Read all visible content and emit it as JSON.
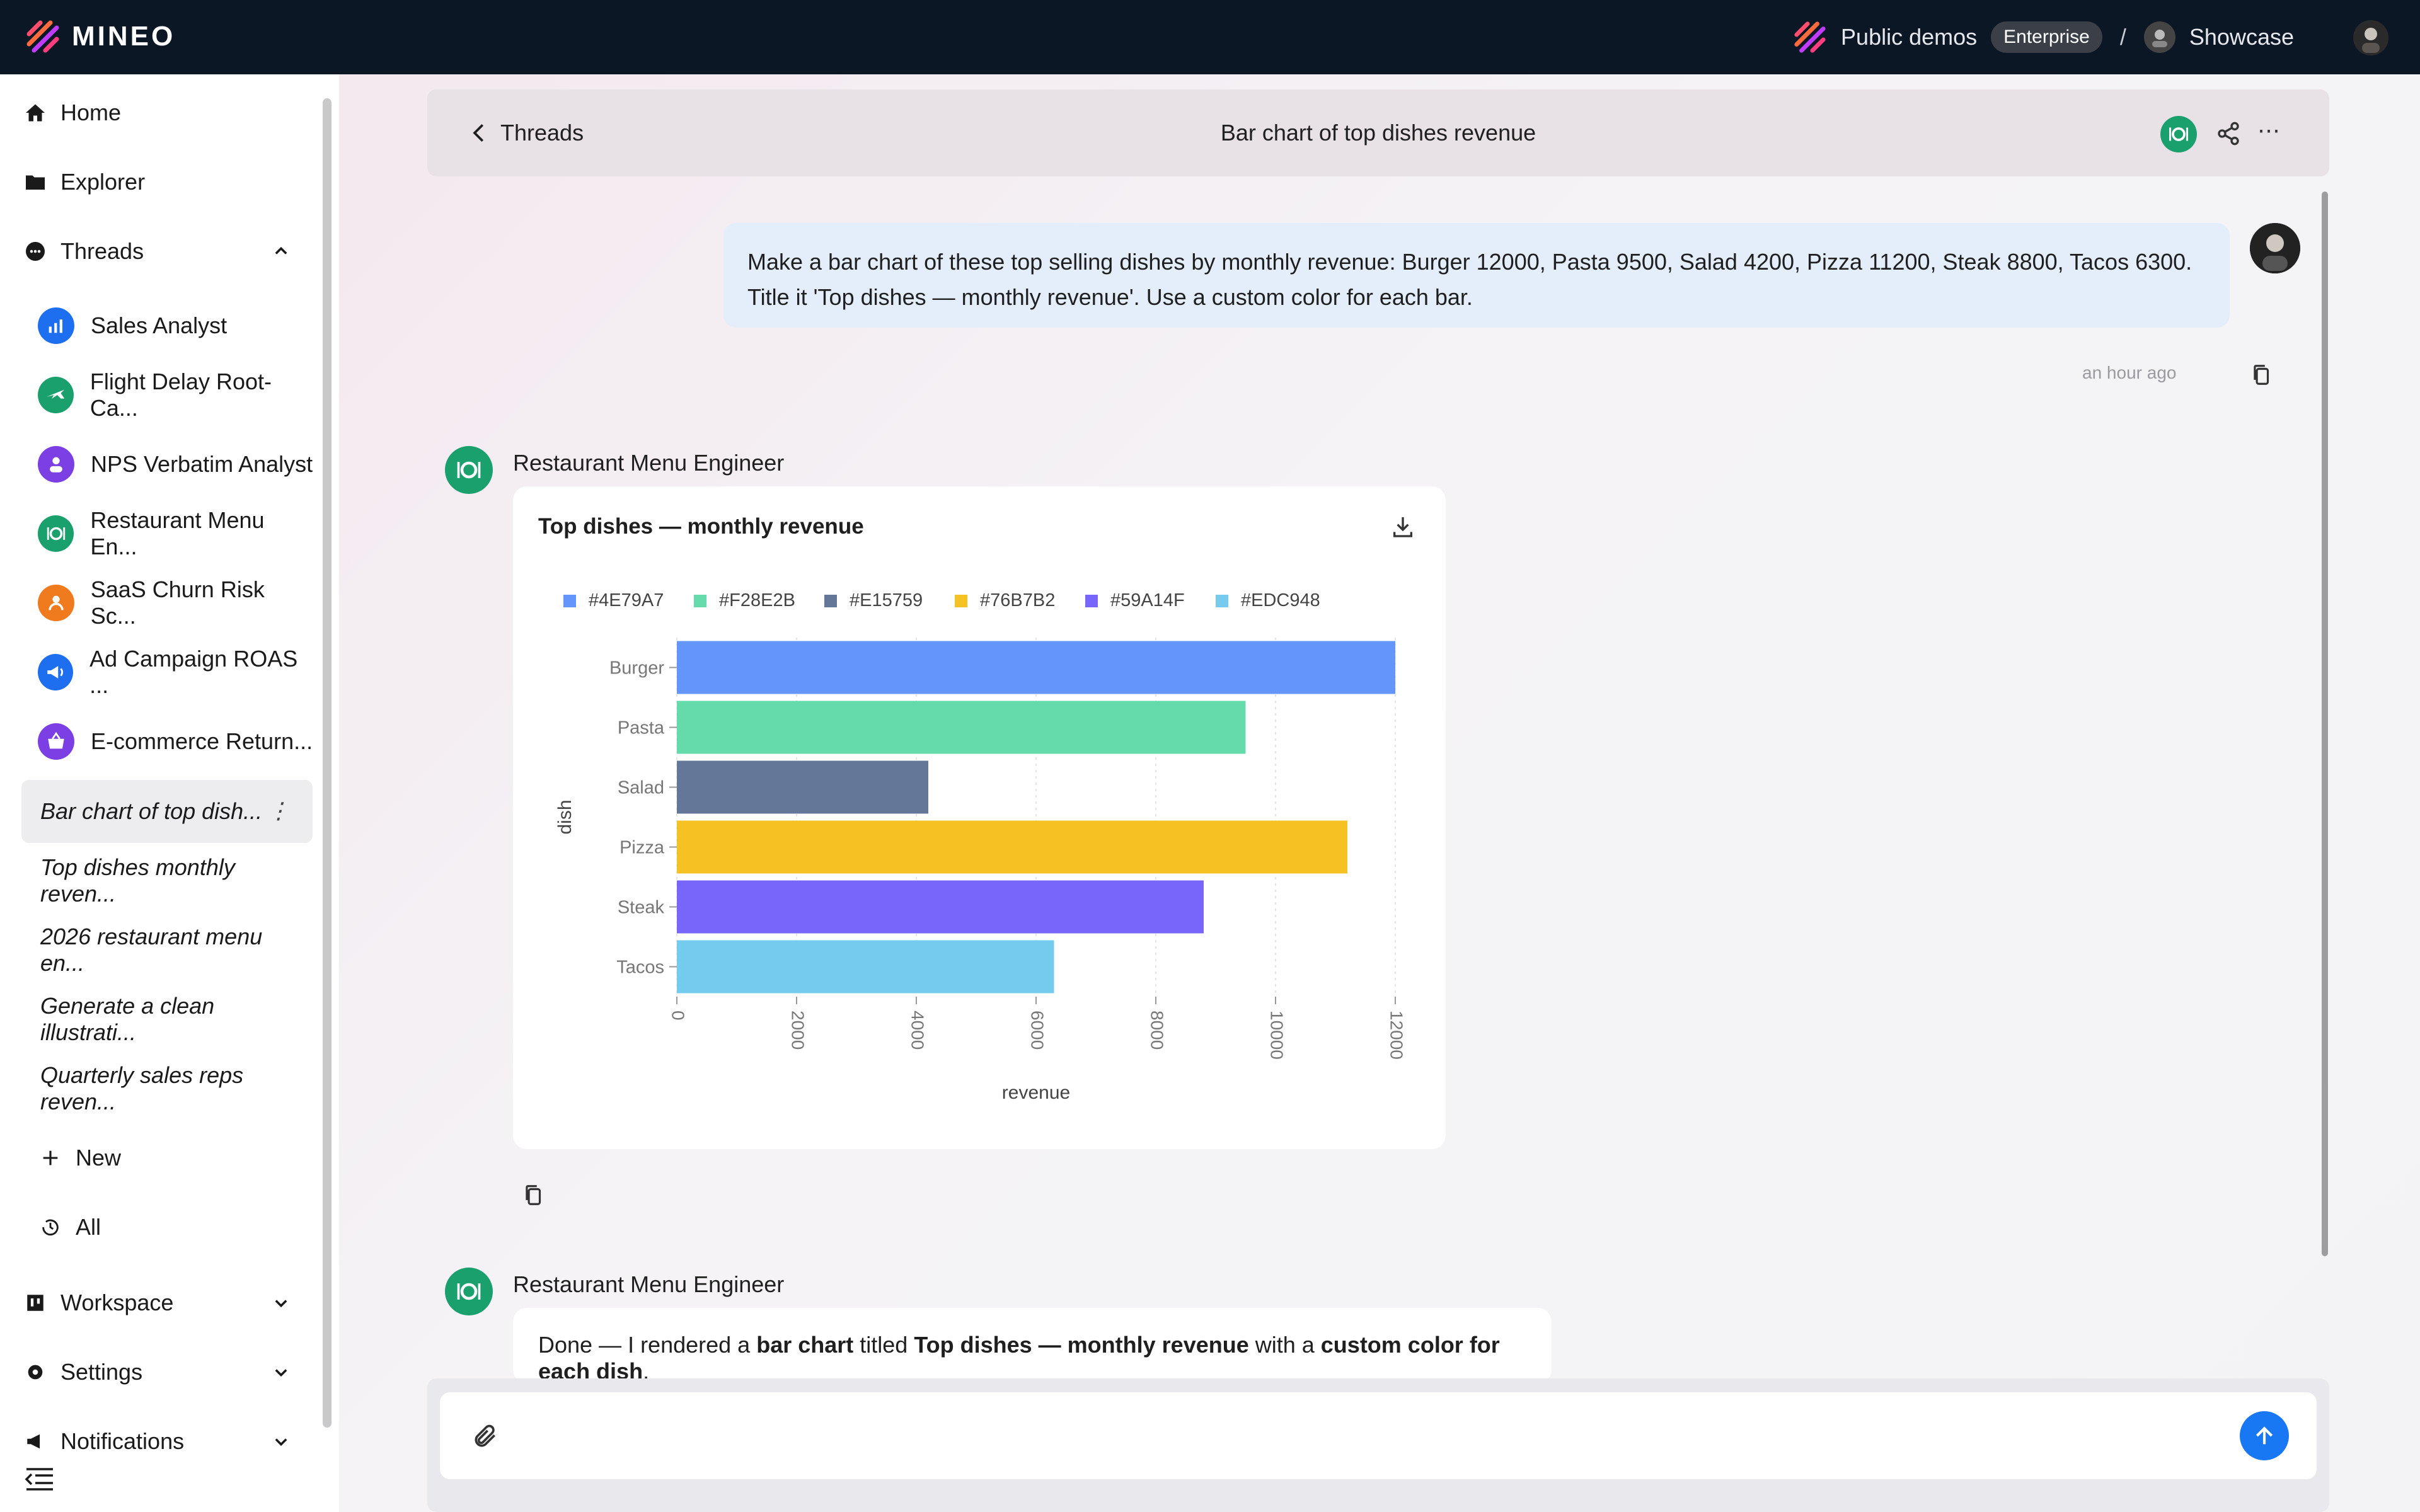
{
  "app": {
    "name": "MINEO"
  },
  "topbar": {
    "org": "Public demos",
    "plan_badge": "Enterprise",
    "separator": "/",
    "project": "Showcase"
  },
  "sidebar": {
    "home": "Home",
    "explorer": "Explorer",
    "threads": "Threads",
    "agents": [
      {
        "label": "Sales Analyst",
        "color": "#1e6ff0"
      },
      {
        "label": "Flight Delay Root-Ca...",
        "color": "#1aa06d"
      },
      {
        "label": "NPS Verbatim Analyst",
        "color": "#7b3fe4"
      },
      {
        "label": "Restaurant Menu En...",
        "color": "#1aa06d"
      },
      {
        "label": "SaaS Churn Risk Sc...",
        "color": "#f07a1e"
      },
      {
        "label": "Ad Campaign ROAS ...",
        "color": "#1e6ff0"
      },
      {
        "label": "E-commerce Return...",
        "color": "#7b3fe4"
      }
    ],
    "thread_history": [
      "Bar chart of top dish...",
      "Top dishes monthly reven...",
      "2026 restaurant menu en...",
      "Generate a clean illustrati...",
      "Quarterly sales reps reven..."
    ],
    "new": "New",
    "all": "All",
    "workspace": "Workspace",
    "settings": "Settings",
    "notifications": "Notifications"
  },
  "thread": {
    "back_label": "Threads",
    "title": "Bar chart of top dishes revenue"
  },
  "messages": {
    "user_prompt": "Make a bar chart of these top selling dishes by monthly revenue: Burger 12000, Pasta 9500, Salad 4200, Pizza 11200, Steak 8800, Tacos 6300. Title it 'Top dishes — monthly revenue'. Use a custom color for each bar.",
    "user_time": "an hour ago",
    "agent_name": "Restaurant Menu Engineer",
    "reply": {
      "prefix": "Done — I rendered a ",
      "bold1": "bar chart",
      "mid1": " titled ",
      "bold2": "Top dishes — monthly revenue",
      "mid2": " with a ",
      "bold3": "custom color for each dish",
      "suffix": "."
    }
  },
  "chart_data": {
    "type": "bar",
    "orientation": "horizontal",
    "title": "Top dishes — monthly revenue",
    "xlabel": "revenue",
    "ylabel": "dish",
    "categories": [
      "Burger",
      "Pasta",
      "Salad",
      "Pizza",
      "Steak",
      "Tacos"
    ],
    "values": [
      12000,
      9500,
      4200,
      11200,
      8800,
      6300
    ],
    "colors": [
      "#6495F9",
      "#65DBAB",
      "#657798",
      "#F6C122",
      "#7766F9",
      "#75CBED"
    ],
    "legend": [
      "#4E79A7",
      "#F28E2B",
      "#E15759",
      "#76B7B2",
      "#59A14F",
      "#EDC948"
    ],
    "legend_colors": [
      "#6495F9",
      "#65DBAB",
      "#657798",
      "#F6C122",
      "#7766F9",
      "#75CBED"
    ],
    "legend_position": "top-left",
    "xticks": [
      "0",
      "2000",
      "4000",
      "6000",
      "8000",
      "10000",
      "12000"
    ],
    "xlim": [
      0,
      12000
    ],
    "grid": true
  }
}
